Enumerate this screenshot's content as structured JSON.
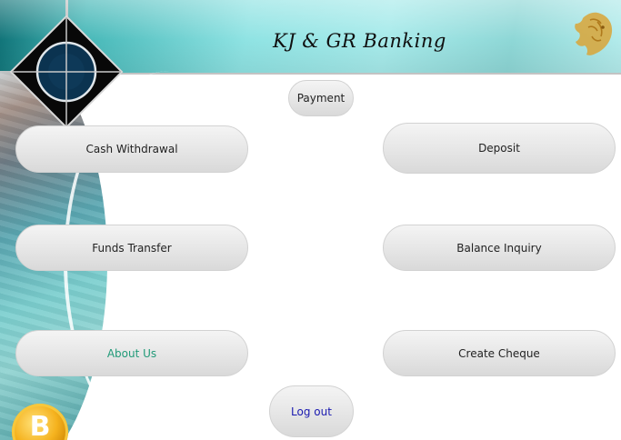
{
  "header": {
    "title": "KJ & GR Banking",
    "logo_icon": "crosshair-diamond-logo",
    "emblem_icon": "lion-head-icon"
  },
  "buttons": {
    "payment": "Payment",
    "cash_withdrawal": "Cash Withdrawal",
    "deposit": "Deposit",
    "funds_transfer": "Funds Transfer",
    "balance_inquiry": "Balance Inquiry",
    "about_us": "About Us",
    "create_cheque": "Create Cheque",
    "log_out": "Log out"
  },
  "decor": {
    "coin_icon": "bitcoin-coin-icon",
    "coin_symbol": "B"
  },
  "colors": {
    "header_teal": "#8fe3e3",
    "about_us_text": "#219a78",
    "logout_text": "#1a1ab0",
    "button_bg": "#e7e7e7"
  }
}
